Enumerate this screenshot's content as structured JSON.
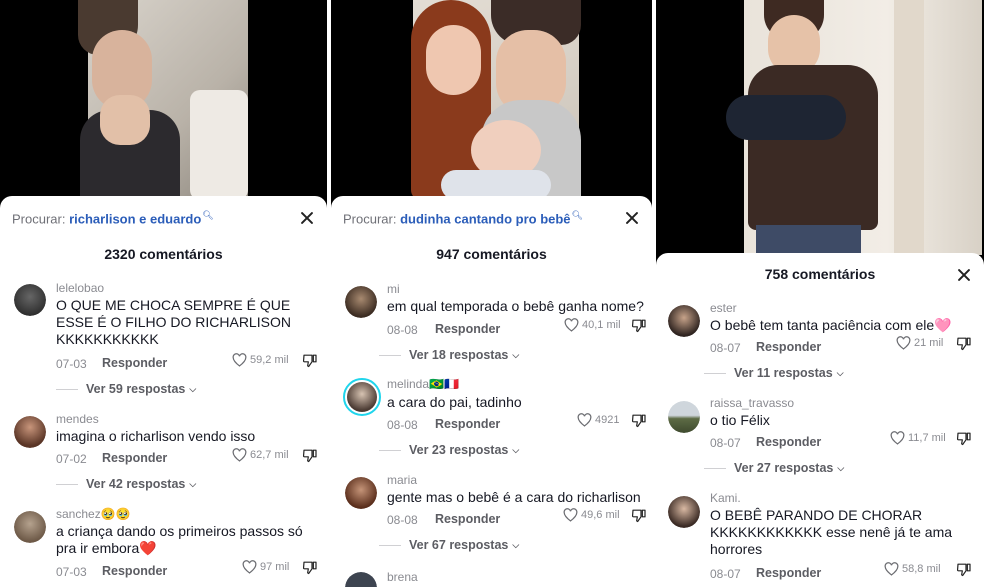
{
  "panels": [
    {
      "search_prefix": "Procurar:",
      "search_query": "richarlison e eduardo",
      "comment_count": "2320 comentários",
      "comments": [
        {
          "user": "lelelobao",
          "text": "O QUE ME CHOCA SEMPRE É QUE ESSE É O FILHO DO RICHARLISON KKKKKKKKKKK",
          "date": "07-03",
          "reply": "Responder",
          "likes": "59,2 mil",
          "more": "Ver 59 respostas"
        },
        {
          "user": "mendes",
          "text": "imagina o richarlison vendo isso",
          "date": "07-02",
          "reply": "Responder",
          "likes": "62,7 mil",
          "more": "Ver 42 respostas"
        },
        {
          "user": "sanchez",
          "user_emoji": "🥹🥹",
          "text": "a criança dando os primeiros passos só pra ir embora",
          "text_emoji": "❤️",
          "date": "07-03",
          "reply": "Responder",
          "likes": "97 mil"
        }
      ]
    },
    {
      "search_prefix": "Procurar:",
      "search_query": "dudinha cantando pro bebê",
      "comment_count": "947 comentários",
      "comments": [
        {
          "user": "mi",
          "text": "em qual temporada o bebê ganha nome?",
          "date": "08-08",
          "reply": "Responder",
          "likes": "40,1 mil",
          "more": "Ver 18 respostas"
        },
        {
          "user": "melinda",
          "user_emoji": "🇧🇷🇫🇷",
          "text": "a cara do pai, tadinho",
          "date": "08-08",
          "reply": "Responder",
          "likes": "4921",
          "more": "Ver 23 respostas"
        },
        {
          "user": "maria",
          "text": "gente mas o bebê é a cara do richarlison",
          "date": "08-08",
          "reply": "Responder",
          "likes": "49,6 mil",
          "more": "Ver 67 respostas"
        },
        {
          "user": "brena"
        }
      ]
    },
    {
      "comment_count": "758 comentários",
      "comments": [
        {
          "user": "ester",
          "text": "O bebê tem tanta paciência com ele",
          "text_emoji": "🩷",
          "date": "08-07",
          "reply": "Responder",
          "likes": "21 mil",
          "more": "Ver 11 respostas"
        },
        {
          "user": "raissa_travasso",
          "text": "o tio Félix",
          "date": "08-07",
          "reply": "Responder",
          "likes": "11,7 mil",
          "more": "Ver 27 respostas"
        },
        {
          "user": "Kami.",
          "text": "O BEBÊ PARANDO DE CHORAR KKKKKKKKKKKK esse nenê já te ama horrores",
          "date": "08-07",
          "reply": "Responder",
          "likes": "58,8 mil"
        }
      ]
    }
  ],
  "colors": {
    "accent_link": "#2b5db9",
    "muted": "#8a8b91",
    "text": "#161823"
  }
}
